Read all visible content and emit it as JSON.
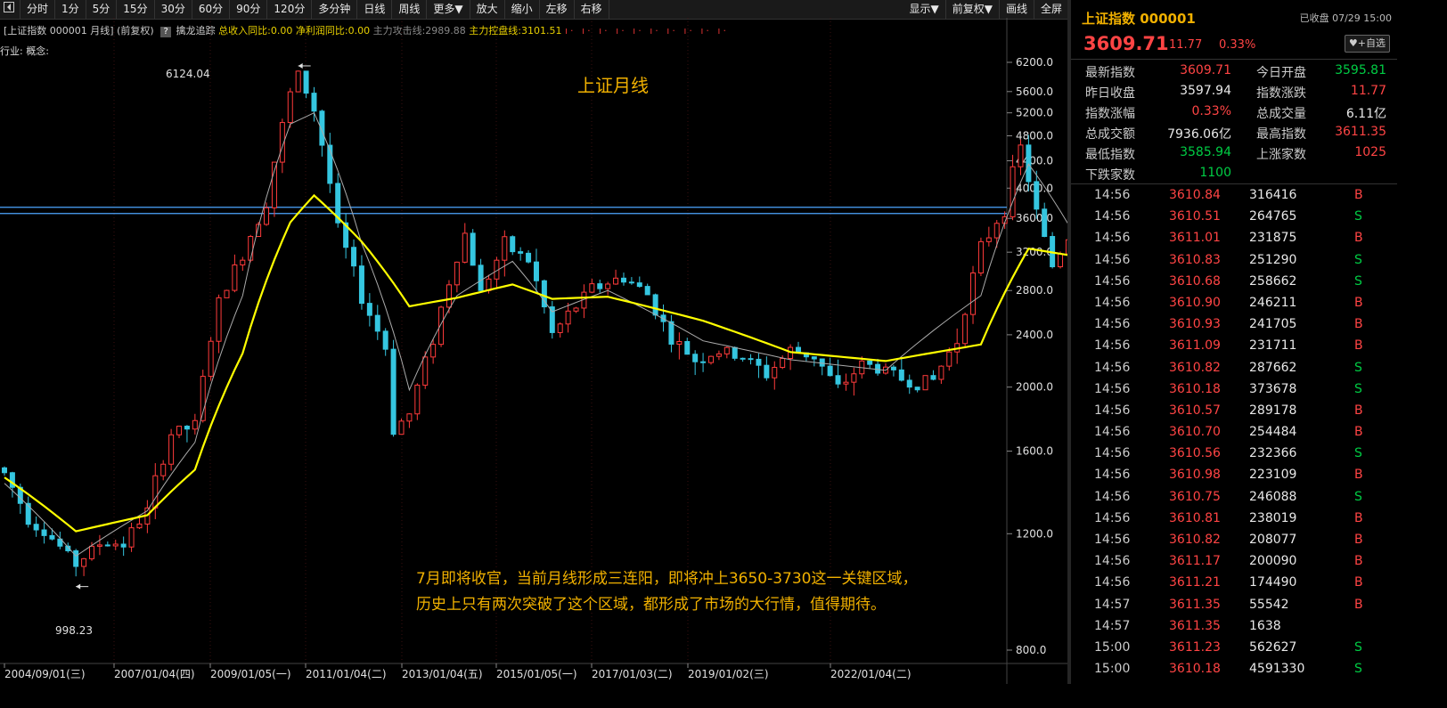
{
  "toolbar": {
    "back_icon": "collapse-left-icon",
    "periods": [
      "分时",
      "1分",
      "5分",
      "15分",
      "30分",
      "60分",
      "90分",
      "120分",
      "多分钟",
      "日线",
      "周线",
      "更多▼"
    ],
    "actions": [
      "放大",
      "缩小",
      "左移",
      "右移"
    ],
    "right": [
      "显示▼",
      "前复权▼",
      "画线",
      "全屏"
    ]
  },
  "info": {
    "title": "[上证指数 000001 月线]",
    "adjust": "(前复权)",
    "help": "?",
    "track": "擒龙追踪",
    "rev": "总收入同比:0.00",
    "profit": "净利润同比:0.00",
    "attack": "主力攻击线:2989.88",
    "control": "主力控盘线:3101.51",
    "markers": "ı· ı· ı· ı· ı· ı· ı· ı· ı· ı·",
    "industry": "行业: 概念:"
  },
  "chart_title": "上证月线",
  "annotation": {
    "line1": "7月即将收官，当前月线形成三连阳，即将冲上3650-3730这一关键区域，",
    "line2": "历史上只有两次突破了这个区域，都形成了市场的大行情，值得期待。"
  },
  "colors": {
    "up": "#ff3b3b",
    "down": "#35c6e0",
    "ma_fast": "#aaaaaa",
    "ma_slow": "#ffff00",
    "key_zone": "#4da6ff",
    "text_accent": "#f0b000"
  },
  "chart_data": {
    "type": "line",
    "title": "上证月线",
    "scale": "log",
    "ylim": [
      800,
      6400
    ],
    "yticks": [
      "6200.0",
      "5600.0",
      "5200.0",
      "4800.0",
      "4400.0",
      "4000.0",
      "3600.0",
      "3200.0",
      "2800.0",
      "2400.0",
      "2000.0",
      "1600.0",
      "1200.0",
      "800.0"
    ],
    "xticks": [
      "2004/09/01(三)",
      "2007/01/04(四)",
      "2009/01/05(一)",
      "2011/01/04(二)",
      "2013/01/04(五)",
      "2015/01/05(一)",
      "2017/01/03(二)",
      "2019/01/02(三)",
      "2022/01/04(二)"
    ],
    "annotations": [
      {
        "label": "6124.04",
        "value": 6124.04,
        "date": "2007-10"
      },
      {
        "label": "998.23",
        "value": 998.23,
        "date": "2005-06"
      }
    ],
    "key_zone": [
      3650,
      3730
    ],
    "series": [
      {
        "role": "close",
        "x": [
          "2004-09",
          "2004-12",
          "2005-03",
          "2005-06",
          "2005-09",
          "2005-12",
          "2006-03",
          "2006-06",
          "2006-09",
          "2006-12",
          "2007-03",
          "2007-06",
          "2007-09",
          "2007-10",
          "2007-12",
          "2008-03",
          "2008-06",
          "2008-09",
          "2008-10",
          "2008-12",
          "2009-03",
          "2009-07",
          "2009-09",
          "2009-12",
          "2010-03",
          "2010-06",
          "2010-09",
          "2010-11",
          "2011-03",
          "2011-06",
          "2011-09",
          "2011-12",
          "2012-03",
          "2012-06",
          "2012-09",
          "2012-12",
          "2013-03",
          "2013-06",
          "2013-09",
          "2013-12",
          "2014-03",
          "2014-06",
          "2014-09",
          "2014-12",
          "2015-03",
          "2015-05",
          "2015-07",
          "2015-09",
          "2015-12",
          "2016-01",
          "2016-06",
          "2016-12",
          "2017-06",
          "2017-12",
          "2018-03",
          "2018-06",
          "2018-09",
          "2018-12",
          "2019-03",
          "2019-06",
          "2019-12",
          "2020-06",
          "2020-12",
          "2021-06",
          "2021-12",
          "2022-03",
          "2022-06",
          "2022-10",
          "2022-12",
          "2023-06",
          "2023-12",
          "2024-01",
          "2024-06",
          "2024-09",
          "2024-12",
          "2025-03",
          "2025-06",
          "2025-07"
        ],
        "values": [
          1480,
          1270,
          1180,
          1080,
          1160,
          1160,
          1300,
          1700,
          1750,
          2675,
          3180,
          3820,
          5550,
          5950,
          5260,
          3470,
          2730,
          2290,
          1730,
          1820,
          2370,
          3410,
          2780,
          3280,
          3110,
          2400,
          2650,
          2820,
          2930,
          2760,
          2360,
          2200,
          2260,
          2220,
          2090,
          2270,
          2230,
          1980,
          2170,
          2120,
          2030,
          2050,
          2360,
          3230,
          3750,
          4610,
          3660,
          3050,
          3540,
          2740,
          2930,
          3100,
          3190,
          3310,
          3160,
          2850,
          2820,
          2490,
          3090,
          2980,
          3050,
          2980,
          3470,
          3590,
          3640,
          3250,
          3400,
          2890,
          3090,
          3200,
          2970,
          2790,
          2970,
          3340,
          3350,
          3340,
          3450,
          3609.71
        ]
      },
      {
        "role": "ma-slow",
        "x": [
          "2004-09",
          "2005-06",
          "2006-03",
          "2006-09",
          "2007-03",
          "2007-09",
          "2007-12",
          "2008-06",
          "2008-12",
          "2009-06",
          "2010-01",
          "2010-06",
          "2011-01",
          "2012-01",
          "2012-12",
          "2013-12",
          "2014-12",
          "2015-06",
          "2016-01",
          "2016-12",
          "2017-12",
          "2018-06",
          "2018-12",
          "2019-06",
          "2019-12",
          "2020-06",
          "2020-12",
          "2021-06",
          "2022-01",
          "2022-06",
          "2023-01",
          "2023-06",
          "2024-01",
          "2024-06",
          "2024-12",
          "2025-07"
        ],
        "values": [
          1460,
          1210,
          1280,
          1500,
          2250,
          3550,
          3900,
          3320,
          2650,
          2730,
          2860,
          2720,
          2740,
          2520,
          2260,
          2190,
          2320,
          3240,
          3140,
          3210,
          3300,
          3160,
          2920,
          2930,
          2920,
          3180,
          3290,
          3460,
          3360,
          3250,
          3220,
          3070,
          3040,
          3090,
          3140,
          3240
        ]
      },
      {
        "role": "ma-fast",
        "x": [
          "2004-09",
          "2005-06",
          "2006-03",
          "2006-09",
          "2007-03",
          "2007-09",
          "2007-12",
          "2008-06",
          "2008-12",
          "2009-06",
          "2010-01",
          "2010-06",
          "2011-01",
          "2012-01",
          "2012-12",
          "2013-12",
          "2014-12",
          "2015-06",
          "2016-01",
          "2016-12",
          "2017-12",
          "2018-06",
          "2018-12",
          "2019-06",
          "2019-12",
          "2020-06",
          "2020-12",
          "2021-06",
          "2022-01",
          "2022-06",
          "2023-01",
          "2023-06",
          "2024-01",
          "2024-06",
          "2024-12",
          "2025-07"
        ],
        "values": [
          1430,
          1110,
          1300,
          1650,
          2750,
          5000,
          5200,
          3300,
          1980,
          2750,
          3100,
          2600,
          2800,
          2350,
          2200,
          2120,
          2750,
          4350,
          3200,
          3120,
          3320,
          3000,
          2620,
          2930,
          2950,
          3170,
          3380,
          3560,
          3450,
          3220,
          3250,
          3020,
          2980,
          3050,
          3270,
          3420
        ]
      }
    ]
  },
  "panel": {
    "name": "上证指数 000001",
    "status": "已收盘 07/29 15:00",
    "price": "3609.71",
    "change": "11.77",
    "pct": "0.33%",
    "fav": "♥+自选",
    "quote": [
      {
        "l1": "最新指数",
        "v1": "3609.71",
        "c1": "red",
        "l2": "今日开盘",
        "v2": "3595.81",
        "c2": "green"
      },
      {
        "l1": "昨日收盘",
        "v1": "3597.94",
        "c1": "white",
        "l2": "指数涨跌",
        "v2": "11.77",
        "c2": "red"
      },
      {
        "l1": "指数涨幅",
        "v1": "0.33%",
        "c1": "red",
        "l2": "总成交量",
        "v2": "6.11亿",
        "c2": "white"
      },
      {
        "l1": "总成交额",
        "v1": "7936.06亿",
        "c1": "white",
        "l2": "最高指数",
        "v2": "3611.35",
        "c2": "red"
      },
      {
        "l1": "最低指数",
        "v1": "3585.94",
        "c1": "green",
        "l2": "上涨家数",
        "v2": "1025",
        "c2": "red"
      },
      {
        "l1": "下跌家数",
        "v1": "1100",
        "c1": "green",
        "l2": "",
        "v2": "",
        "c2": "white"
      }
    ],
    "ticks": [
      {
        "t": "14:56",
        "p": "3610.84",
        "v": "316416",
        "d": "B"
      },
      {
        "t": "14:56",
        "p": "3610.51",
        "v": "264765",
        "d": "S"
      },
      {
        "t": "14:56",
        "p": "3611.01",
        "v": "231875",
        "d": "B"
      },
      {
        "t": "14:56",
        "p": "3610.83",
        "v": "251290",
        "d": "S"
      },
      {
        "t": "14:56",
        "p": "3610.68",
        "v": "258662",
        "d": "S"
      },
      {
        "t": "14:56",
        "p": "3610.90",
        "v": "246211",
        "d": "B"
      },
      {
        "t": "14:56",
        "p": "3610.93",
        "v": "241705",
        "d": "B"
      },
      {
        "t": "14:56",
        "p": "3611.09",
        "v": "231711",
        "d": "B"
      },
      {
        "t": "14:56",
        "p": "3610.82",
        "v": "287662",
        "d": "S"
      },
      {
        "t": "14:56",
        "p": "3610.18",
        "v": "373678",
        "d": "S"
      },
      {
        "t": "14:56",
        "p": "3610.57",
        "v": "289178",
        "d": "B"
      },
      {
        "t": "14:56",
        "p": "3610.70",
        "v": "254484",
        "d": "B"
      },
      {
        "t": "14:56",
        "p": "3610.56",
        "v": "232366",
        "d": "S"
      },
      {
        "t": "14:56",
        "p": "3610.98",
        "v": "223109",
        "d": "B"
      },
      {
        "t": "14:56",
        "p": "3610.75",
        "v": "246088",
        "d": "S"
      },
      {
        "t": "14:56",
        "p": "3610.81",
        "v": "238019",
        "d": "B"
      },
      {
        "t": "14:56",
        "p": "3610.82",
        "v": "208077",
        "d": "B"
      },
      {
        "t": "14:56",
        "p": "3611.17",
        "v": "200090",
        "d": "B"
      },
      {
        "t": "14:56",
        "p": "3611.21",
        "v": "174490",
        "d": "B"
      },
      {
        "t": "14:57",
        "p": "3611.35",
        "v": "55542",
        "d": "B"
      },
      {
        "t": "14:57",
        "p": "3611.35",
        "v": "1638",
        "d": ""
      },
      {
        "t": "15:00",
        "p": "3611.23",
        "v": "562627",
        "d": "S"
      },
      {
        "t": "15:00",
        "p": "3610.18",
        "v": "4591330",
        "d": "S"
      }
    ]
  }
}
